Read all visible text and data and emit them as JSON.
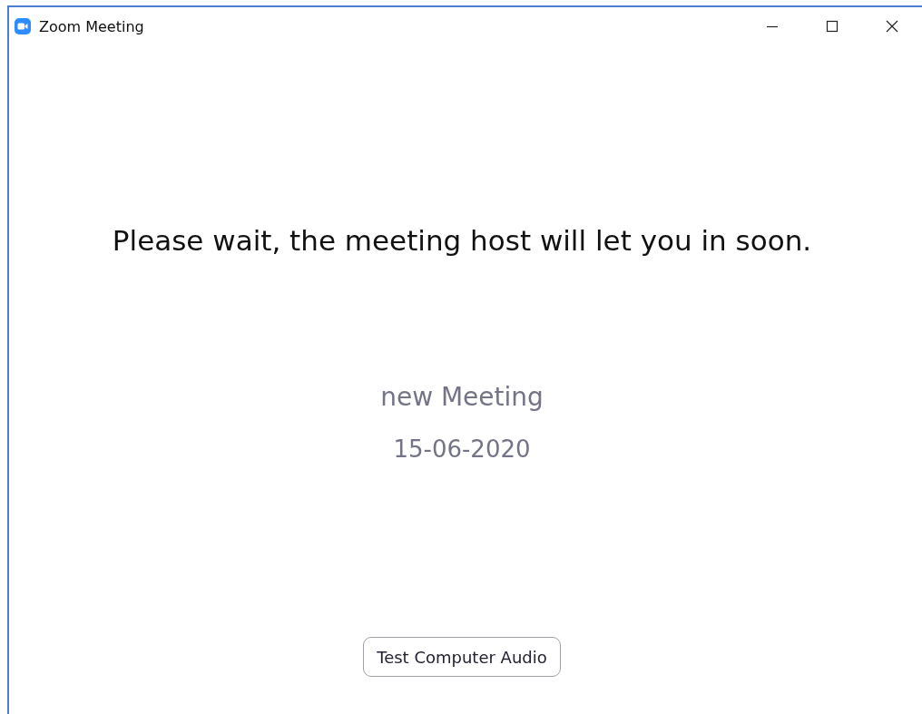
{
  "window": {
    "title": "Zoom Meeting"
  },
  "message": "Please wait, the meeting host will let you in soon.",
  "meeting": {
    "name": "new Meeting",
    "date": "15-06-2020"
  },
  "buttons": [
    "Test Computer Audio"
  ]
}
